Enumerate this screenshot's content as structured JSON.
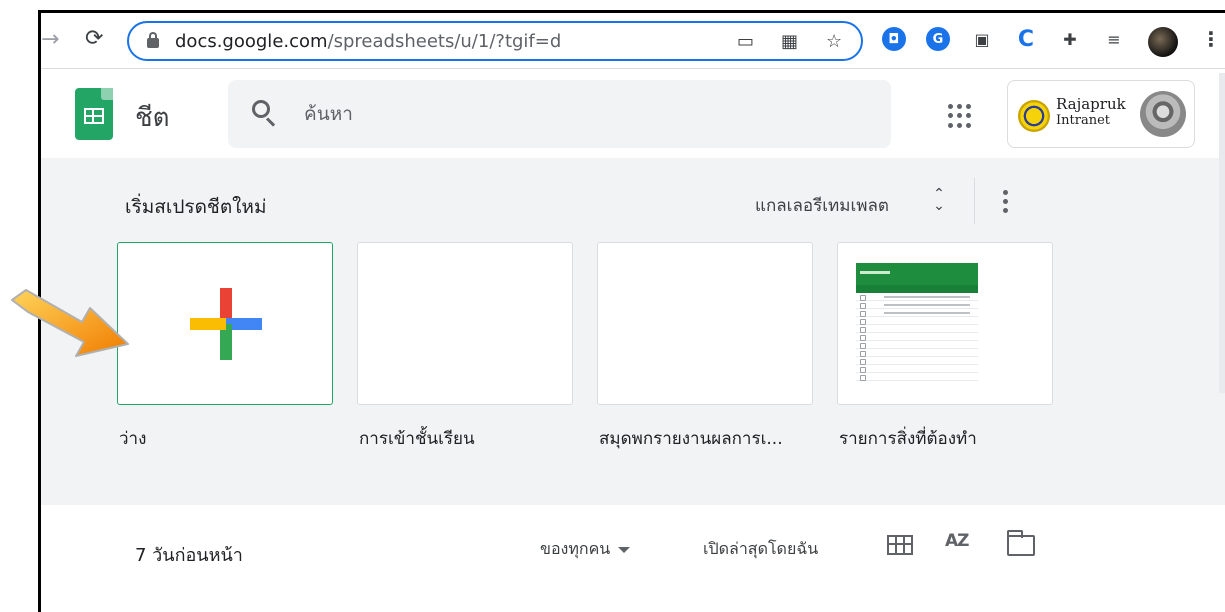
{
  "browser": {
    "url_host": "docs.google.com",
    "url_path": "/spreadsheets/u/1/?tgif=d"
  },
  "app": {
    "title": "ชีต",
    "search_placeholder": "ค้นหา"
  },
  "account": {
    "org_name": "Rajapruk",
    "org_sub": "Intranet"
  },
  "gallery": {
    "title": "เริ่มสเปรดชีตใหม่",
    "template_gallery_label": "แกลเลอรีเทมเพลต",
    "templates": [
      {
        "label": "ว่าง"
      },
      {
        "label": "การเข้าชั้นเรียน"
      },
      {
        "label": "สมุดพกรายงานผลการเ..."
      },
      {
        "label": "รายการสิ่งที่ต้องทำ"
      }
    ]
  },
  "recent": {
    "title": "7 วันก่อนหน้า",
    "owner_filter": "ของทุกคน",
    "sort_label": "เปิดล่าสุดโดยฉัน",
    "az_glyph": "AZ"
  },
  "colors": {
    "accent": "#1a73e8",
    "sheets_green": "#23a566",
    "gallery_bg": "#f1f3f4",
    "arrow_orange": "#f7941d"
  }
}
